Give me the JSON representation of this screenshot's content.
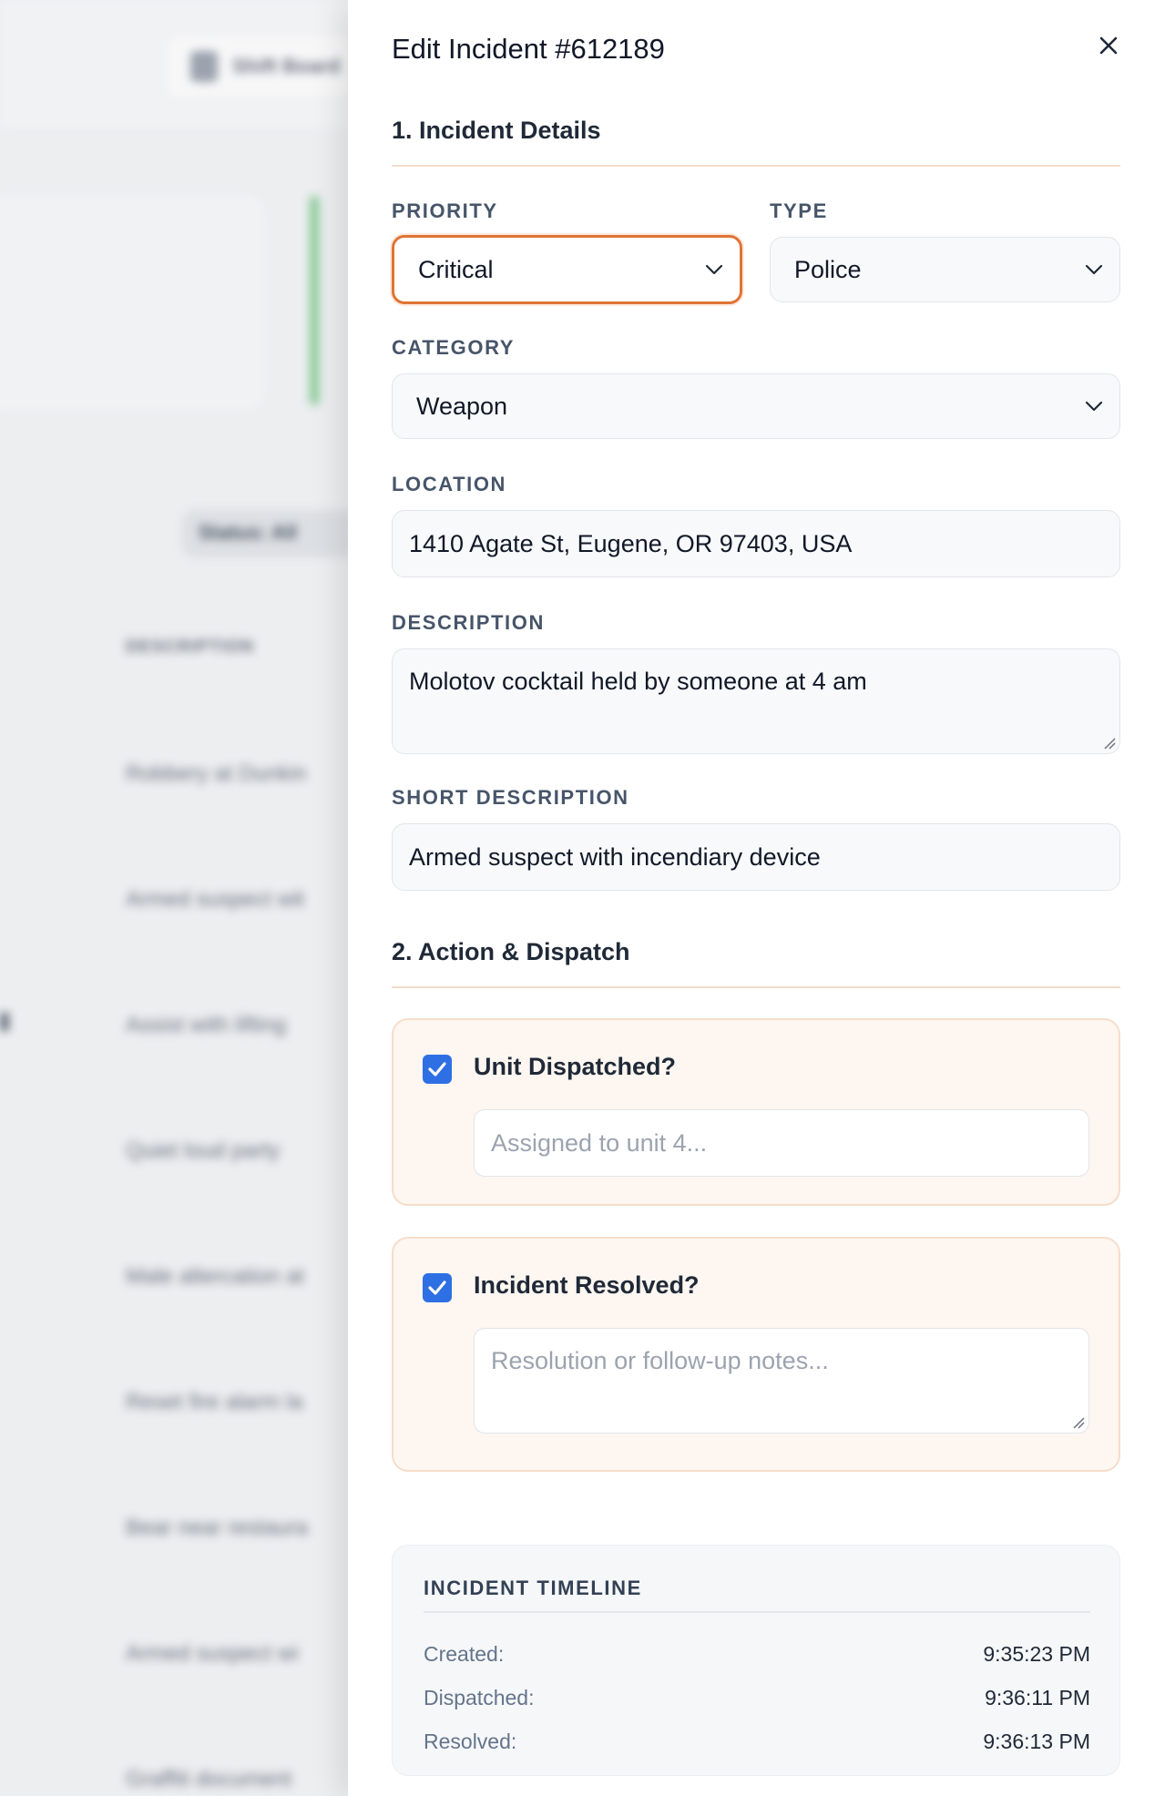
{
  "background": {
    "button_label": "Shift Board",
    "filter_label": "Status: All",
    "table_header": "DESCRIPTION",
    "rows": [
      "Robbery at Dunkin",
      "Armed suspect wit",
      "Assist with lifting",
      "Quiet loud party",
      "Male altercation at",
      "Reset fire alarm la",
      "Bear near restaura",
      "Armed suspect wi",
      "Graffiti document"
    ]
  },
  "modal": {
    "title": "Edit Incident #612189",
    "section1": "1. Incident Details",
    "priority": {
      "label": "PRIORITY",
      "value": "Critical"
    },
    "type": {
      "label": "TYPE",
      "value": "Police"
    },
    "category": {
      "label": "CATEGORY",
      "value": "Weapon"
    },
    "location": {
      "label": "LOCATION",
      "value": "1410 Agate St, Eugene, OR 97403, USA"
    },
    "description": {
      "label": "DESCRIPTION",
      "value": "Molotov cocktail held by someone at 4 am"
    },
    "short_description": {
      "label": "SHORT DESCRIPTION",
      "value": "Armed suspect with incendiary device"
    },
    "section2": "2. Action & Dispatch",
    "unit_dispatched": {
      "label": "Unit Dispatched?",
      "checked": true,
      "placeholder": "Assigned to unit 4..."
    },
    "incident_resolved": {
      "label": "Incident Resolved?",
      "checked": true,
      "placeholder": "Resolution or follow-up notes..."
    },
    "timeline": {
      "title": "INCIDENT TIMELINE",
      "rows": [
        {
          "key": "Created:",
          "value": "9:35:23 PM"
        },
        {
          "key": "Dispatched:",
          "value": "9:36:11 PM"
        },
        {
          "key": "Resolved:",
          "value": "9:36:13 PM"
        }
      ]
    }
  },
  "colors": {
    "accent_focus": "#e07434",
    "checkbox": "#2f6fe4",
    "card_bg": "#fdf6f1"
  }
}
